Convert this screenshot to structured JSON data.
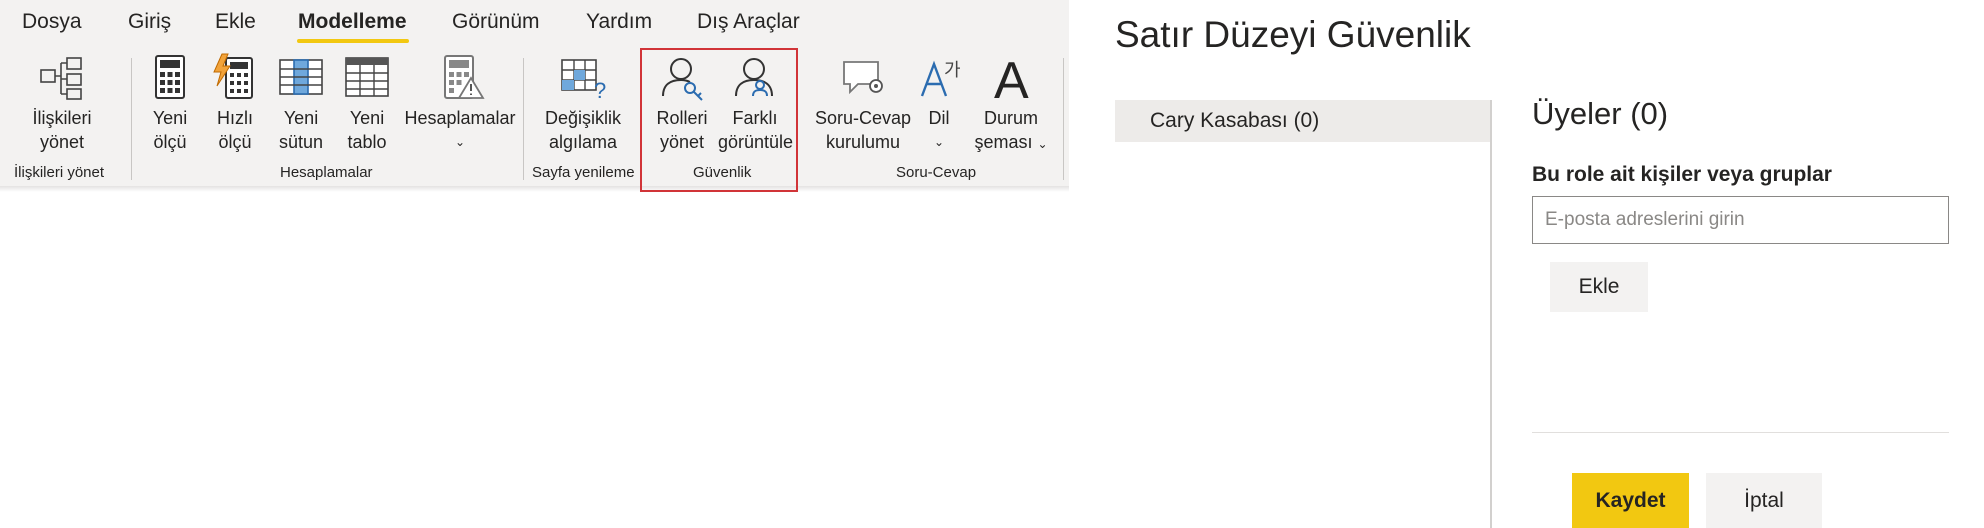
{
  "ribbon": {
    "tabs": [
      {
        "label": "Dosya"
      },
      {
        "label": "Giriş"
      },
      {
        "label": "Ekle"
      },
      {
        "label": "Modelleme"
      },
      {
        "label": "Görünüm"
      },
      {
        "label": "Yardım"
      },
      {
        "label": "Dış Araçlar"
      }
    ],
    "active_tab": "Modelleme",
    "buttons": {
      "manage_relationships": {
        "line1": "İlişkileri",
        "line2": "yönet",
        "icon": "relationships-icon"
      },
      "new_measure": {
        "line1": "Yeni",
        "line2": "ölçü",
        "icon": "calculator-icon"
      },
      "quick_measure": {
        "line1": "Hızlı",
        "line2": "ölçü",
        "icon": "quick-measure-icon"
      },
      "new_column": {
        "line1": "Yeni",
        "line2": "sütun",
        "icon": "new-column-icon"
      },
      "new_table": {
        "line1": "Yeni",
        "line2": "tablo",
        "icon": "new-table-icon"
      },
      "calculations": {
        "line1": "Hesaplamalar",
        "icon": "calculation-icon"
      },
      "change_detection": {
        "line1": "Değişiklik",
        "line2": "algılama",
        "icon": "change-detection-icon"
      },
      "manage_roles": {
        "line1": "Rolleri",
        "line2": "yönet",
        "icon": "manage-roles-icon"
      },
      "view_as": {
        "line1": "Farklı",
        "line2": "görüntüle",
        "icon": "view-as-icon"
      },
      "qa_setup": {
        "line1": "Soru-Cevap",
        "line2": "kurulumu",
        "icon": "qa-icon"
      },
      "language": {
        "line1": "Dil",
        "icon": "language-icon"
      },
      "linguistic_schema": {
        "line1": "Durum",
        "line2": "şeması",
        "icon": "linguistic-schema-icon"
      }
    },
    "groups": {
      "relationships": "İlişkileri yönet",
      "calculations": "Hesaplamalar",
      "page_refresh": "Sayfa yenileme",
      "security": "Güvenlik",
      "qa": "Soru-Cevap"
    },
    "accent_color": "#f2c811",
    "highlight_color": "#d13438"
  },
  "dialog": {
    "title": "Satır Düzeyi Güvenlik",
    "roles": [
      {
        "label": "Cary Kasabası (0)"
      }
    ],
    "members_title": "Üyeler (0)",
    "members_subtitle": "Bu role ait kişiler veya gruplar",
    "email_placeholder": "E-posta adreslerini girin",
    "email_value": "",
    "add_label": "Ekle",
    "save_label": "Kaydet",
    "cancel_label": "İptal"
  }
}
